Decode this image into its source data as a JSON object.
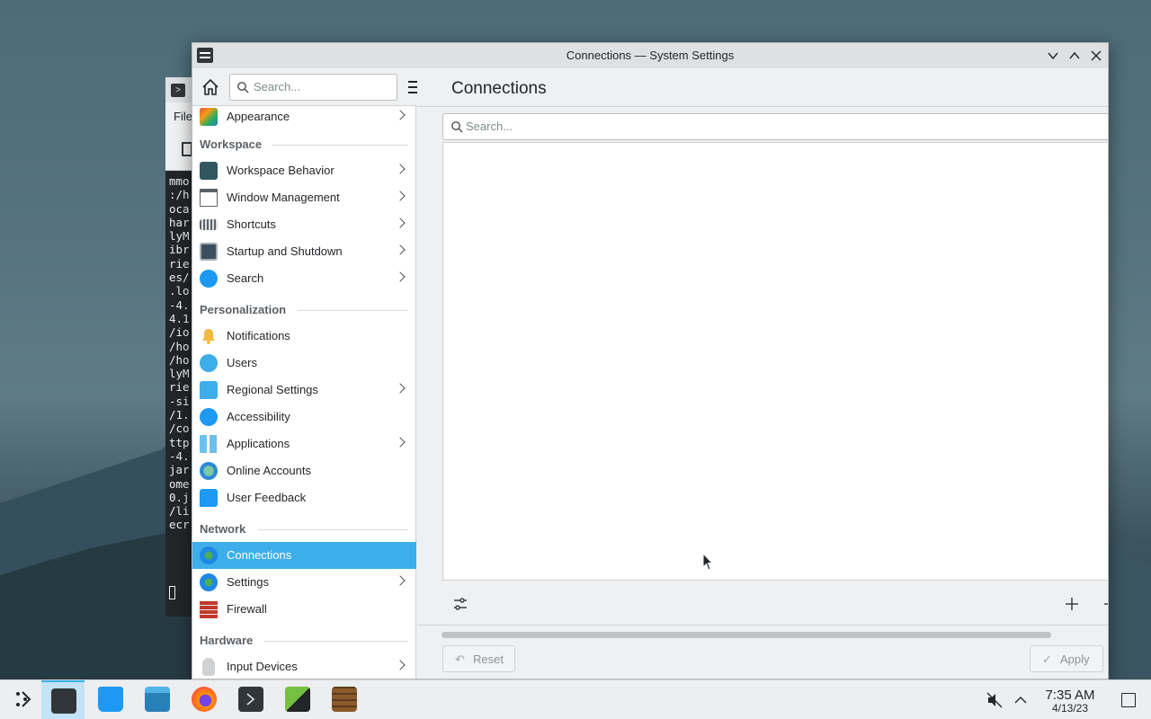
{
  "window": {
    "title": "Connections — System Settings"
  },
  "terminal": {
    "menu_label": "File",
    "lines": [
      "mmo",
      ":/h",
      "oca",
      "har",
      "lyM",
      "ibr",
      "rie",
      "es/",
      ".lo",
      "-4.",
      "4.1",
      "/io",
      "/ho",
      "/ho",
      "lyM",
      "rie",
      "-si",
      "/1.",
      "/co",
      "ttp",
      "-4.",
      "jar",
      "ome",
      "0.j",
      "/li",
      "ecr"
    ]
  },
  "sidebar": {
    "search_placeholder": "Search...",
    "items": {
      "appearance": "Appearance",
      "workspace_section": "Workspace",
      "workspace_behavior": "Workspace Behavior",
      "window_management": "Window Management",
      "shortcuts": "Shortcuts",
      "startup_shutdown": "Startup and Shutdown",
      "search": "Search",
      "personalization_section": "Personalization",
      "notifications": "Notifications",
      "users": "Users",
      "regional_settings": "Regional Settings",
      "accessibility": "Accessibility",
      "applications": "Applications",
      "online_accounts": "Online Accounts",
      "user_feedback": "User Feedback",
      "network_section": "Network",
      "connections": "Connections",
      "settings": "Settings",
      "firewall": "Firewall",
      "hardware_section": "Hardware",
      "input_devices": "Input Devices"
    }
  },
  "content": {
    "title": "Connections",
    "search_placeholder": "Search...",
    "reset_label": "Reset",
    "apply_label": "Apply"
  },
  "taskbar": {
    "time": "7:35 AM",
    "date": "4/13/23"
  },
  "colors": {
    "accent": "#3daee9",
    "selected_text": "#ffffff"
  }
}
